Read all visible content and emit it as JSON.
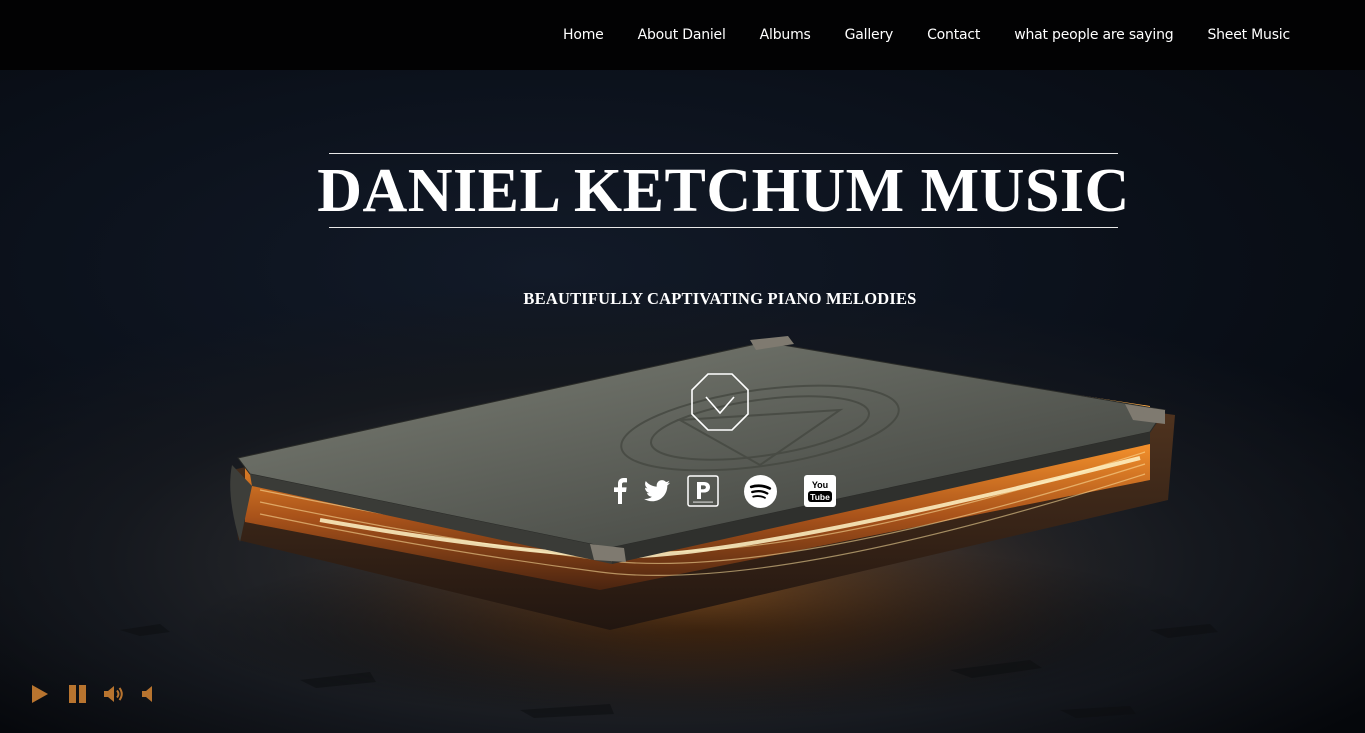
{
  "nav": {
    "items": [
      {
        "label": "Home"
      },
      {
        "label": "About Daniel"
      },
      {
        "label": "Albums"
      },
      {
        "label": "Gallery"
      },
      {
        "label": "Contact"
      },
      {
        "label": "what people are saying"
      },
      {
        "label": "Sheet Music"
      }
    ]
  },
  "hero": {
    "title": "DANIEL KETCHUM MUSIC",
    "subtitle": "BEAUTIFULLY CAPTIVATING PIANO MELODIES",
    "scroll_icon": "octagon-chevron-down-icon"
  },
  "social": {
    "icons": [
      "facebook-icon",
      "twitter-icon",
      "pandora-icon",
      "spotify-icon",
      "youtube-icon"
    ],
    "youtube_text_top": "You",
    "youtube_text_bottom": "Tube"
  },
  "player": {
    "icons": [
      "play-icon",
      "pause-icon",
      "volume-up-icon",
      "volume-down-icon"
    ],
    "color": "#b8742f"
  },
  "colors": {
    "nav_bg": "#020203",
    "text": "#ffffff",
    "book_glow": "#ff9a2e"
  }
}
